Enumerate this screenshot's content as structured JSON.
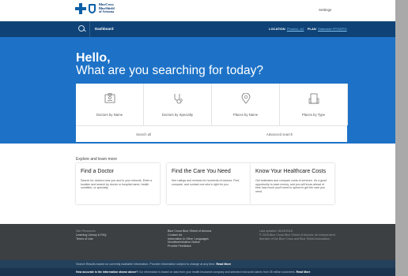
{
  "header": {
    "logo_lines": [
      "BlueCross",
      "BlueShield",
      "of Arizona"
    ],
    "settings_label": "Settings"
  },
  "nav": {
    "dashboard_label": "Dashboard",
    "location_label": "LOCATION",
    "location_value": "Phoenix, AZ",
    "plan_label": "PLAN",
    "plan_value": "Statewide PPO/EPO"
  },
  "hero": {
    "greeting": "Hello,",
    "question": "What are you searching for today?"
  },
  "search_tiles": [
    {
      "label": "Doctors by Name",
      "icon": "doctor-card-icon"
    },
    {
      "label": "Doctors by Specialty",
      "icon": "stethoscope-icon"
    },
    {
      "label": "Places by Name",
      "icon": "map-pin-icon"
    },
    {
      "label": "Places by Type",
      "icon": "building-icon"
    }
  ],
  "search_footer": {
    "search_all": "Search all",
    "advanced": "Advanced search"
  },
  "explore": {
    "title": "Explore and learn more",
    "cards": [
      {
        "heading": "Find a Doctor",
        "text": "Search for doctors near you and in your network. Enter a location and search by doctor or hospital name, health condition, or specialty."
      },
      {
        "heading": "Find the Care You Need",
        "text": "See ratings and reviews for hundreds of doctors. Find, compare, and contact one who's right for you."
      },
      {
        "heading": "Know Your Healthcare Costs",
        "text": "Get estimates and compare costs of services. It's a good opportunity to save money, and you will know ahead of time how much you'll need to spend to get the care you need."
      }
    ]
  },
  "footer": {
    "col1": [
      "Site Resources",
      "Learning Library & FAQ",
      "Terms of Use"
    ],
    "col2": [
      "Blue Cross Blue Shield of Arizona",
      "Contact Us",
      "Information in Other Languages",
      "Nondiscrimination Notice",
      "Provide Feedback"
    ],
    "col3": [
      "Last updated: 06/18/2018",
      "© 2018 Blue Cross Blue Shield of Arizona. An independent",
      "licensee of the Blue Cross and Blue Shield Association."
    ]
  },
  "bottom_notice": {
    "line1_text": "Search Results based on currently available information. Provider information subject to change at any time.",
    "line1_link": "Read More",
    "line2_bold": "How accurate is the information shown above?",
    "line2_text": "Our information is based on data from your health insurance company and selected real-world claims from 35 million customers.",
    "line2_link": "Read More"
  }
}
